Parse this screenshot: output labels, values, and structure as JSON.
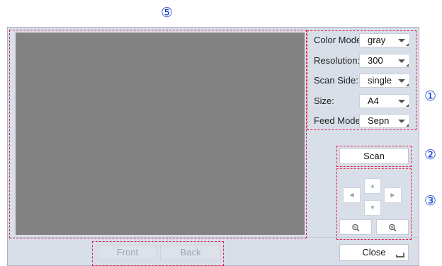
{
  "callouts": {
    "c1": "①",
    "c2": "②",
    "c3": "③",
    "c5": "⑤"
  },
  "settings": {
    "color_mode": {
      "label": "Color Mode:",
      "value": "gray"
    },
    "resolution": {
      "label": "Resolution:",
      "value": "300"
    },
    "scan_side": {
      "label": "Scan Side:",
      "value": "single"
    },
    "size": {
      "label": "Size:",
      "value": "A4"
    },
    "feed_mode": {
      "label": "Feed Mode:",
      "value": "Sepn"
    }
  },
  "buttons": {
    "scan": "Scan",
    "close": "Close",
    "front": "Front",
    "back": "Back"
  },
  "navigation": {
    "up": "▲",
    "down": "▼",
    "left": "◀",
    "right": "▶",
    "zoom_out": "zoom-out-icon",
    "zoom_in": "zoom-in-icon"
  },
  "colors": {
    "callout": "#1a3fd6",
    "dashed_outline": "#e0204a",
    "preview": "#828282"
  }
}
